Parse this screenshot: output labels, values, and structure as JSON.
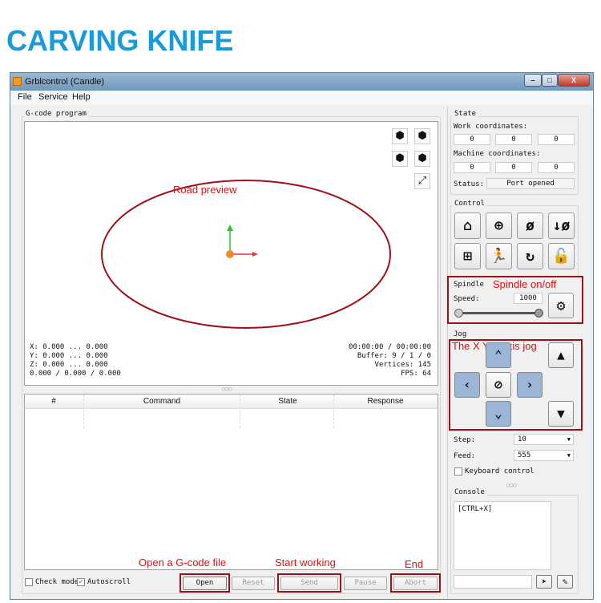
{
  "banner": "CARVING KNIFE",
  "window": {
    "title": "Grblcontrol  (Candle)",
    "min": "–",
    "max": "□",
    "close": "X"
  },
  "menu": [
    "File",
    "Service",
    "Help"
  ],
  "gcode": {
    "label": "G-code program",
    "info_left": [
      "X: 0.000 ... 0.000",
      "Y: 0.000 ... 0.000",
      "Z: 0.000 ... 0.000",
      "0.000 / 0.000 / 0.000"
    ],
    "info_right": [
      "00:00:00 / 00:00:00",
      "Buffer: 9 / 1 / 0",
      "Vertices: 145",
      "FPS: 64"
    ],
    "splitter": "○○○"
  },
  "table": {
    "headers": [
      "#",
      "Command",
      "State",
      "Response"
    ]
  },
  "bottom": {
    "check_mode": "Check mode",
    "autoscroll": "Autoscroll",
    "autoscroll_checked": "✓",
    "open": "Open",
    "reset": "Reset",
    "send": "Send",
    "pause": "Pause",
    "abort": "Abort"
  },
  "state": {
    "label": "State",
    "work_label": "Work coordinates:",
    "work": [
      "0",
      "0",
      "0"
    ],
    "machine_label": "Machine coordinates:",
    "machine": [
      "0",
      "0",
      "0"
    ],
    "status_label": "Status:",
    "status": "Port opened"
  },
  "control": {
    "label": "Control"
  },
  "spindle": {
    "label": "Spindle",
    "speed_label": "Speed:",
    "speed": "1000",
    "slider_fraction": 1.0
  },
  "jog": {
    "label": "Jog",
    "step_label": "Step:",
    "step": "10",
    "feed_label": "Feed:",
    "feed": "555",
    "keyboard": "Keyboard control"
  },
  "console": {
    "label": "Console",
    "text": "[CTRL+X]",
    "splitter": "○○○"
  },
  "annotations": {
    "road": "Road preview",
    "spindle": "Spindle on/off",
    "jog": "The X Y Z axis jog",
    "open": "Open a G-code file",
    "start": "Start working",
    "end": "End"
  },
  "colors": {
    "banner": "#1a9ad8",
    "annotation": "#e01010",
    "frame": "#a01018",
    "jog_blue": "#9bb6d6"
  }
}
